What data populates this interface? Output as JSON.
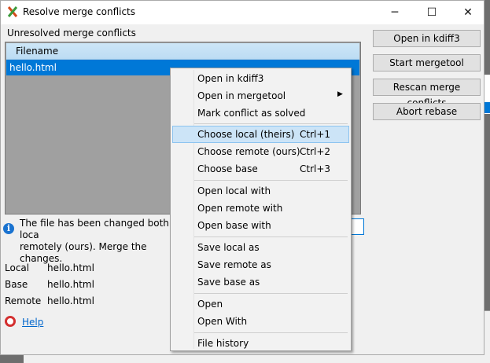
{
  "window": {
    "title": "Resolve merge conflicts",
    "min": "─",
    "max": "☐",
    "close": "✕"
  },
  "section_label": "Unresolved merge conflicts",
  "list": {
    "header": "Filename",
    "rows": [
      "hello.html"
    ]
  },
  "buttons": [
    "Open in kdiff3",
    "Start mergetool",
    "Rescan merge conflicts",
    "Abort rebase"
  ],
  "info": {
    "line1": "The file has been changed both loca",
    "line2": "remotely (ours). Merge the changes."
  },
  "files": [
    {
      "label": "Local",
      "value": "hello.html"
    },
    {
      "label": "Base",
      "value": "hello.html"
    },
    {
      "label": "Remote",
      "value": "hello.html"
    }
  ],
  "help": "Help",
  "menu": {
    "items": [
      {
        "label": "Open in kdiff3",
        "shortcut": ""
      },
      {
        "label": "Open in mergetool",
        "shortcut": "",
        "submenu": "▶"
      },
      {
        "label": "Mark conflict as solved",
        "shortcut": ""
      },
      {
        "label": "Choose local (theirs)",
        "shortcut": "Ctrl+1"
      },
      {
        "label": "Choose remote (ours)",
        "shortcut": "Ctrl+2"
      },
      {
        "label": "Choose base",
        "shortcut": "Ctrl+3"
      },
      {
        "label": "Open local with",
        "shortcut": ""
      },
      {
        "label": "Open remote with",
        "shortcut": ""
      },
      {
        "label": "Open base with",
        "shortcut": ""
      },
      {
        "label": "Save local as",
        "shortcut": ""
      },
      {
        "label": "Save remote as",
        "shortcut": ""
      },
      {
        "label": "Save base as",
        "shortcut": ""
      },
      {
        "label": "Open",
        "shortcut": ""
      },
      {
        "label": "Open With",
        "shortcut": ""
      },
      {
        "label": "File history",
        "shortcut": ""
      }
    ]
  },
  "colors": {
    "selection": "#0078d7",
    "highlight": "#cce4f7",
    "link": "#0066cc"
  }
}
